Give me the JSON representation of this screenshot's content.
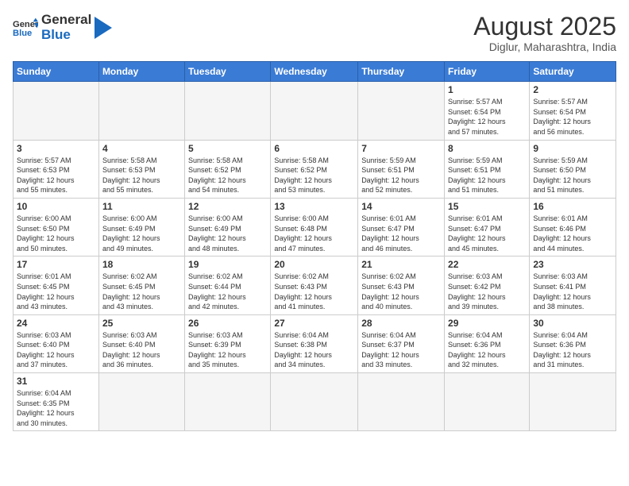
{
  "logo": {
    "text_general": "General",
    "text_blue": "Blue"
  },
  "header": {
    "month_title": "August 2025",
    "subtitle": "Diglur, Maharashtra, India"
  },
  "weekdays": [
    "Sunday",
    "Monday",
    "Tuesday",
    "Wednesday",
    "Thursday",
    "Friday",
    "Saturday"
  ],
  "weeks": [
    [
      {
        "day": "",
        "info": ""
      },
      {
        "day": "",
        "info": ""
      },
      {
        "day": "",
        "info": ""
      },
      {
        "day": "",
        "info": ""
      },
      {
        "day": "",
        "info": ""
      },
      {
        "day": "1",
        "info": "Sunrise: 5:57 AM\nSunset: 6:54 PM\nDaylight: 12 hours\nand 57 minutes."
      },
      {
        "day": "2",
        "info": "Sunrise: 5:57 AM\nSunset: 6:54 PM\nDaylight: 12 hours\nand 56 minutes."
      }
    ],
    [
      {
        "day": "3",
        "info": "Sunrise: 5:57 AM\nSunset: 6:53 PM\nDaylight: 12 hours\nand 55 minutes."
      },
      {
        "day": "4",
        "info": "Sunrise: 5:58 AM\nSunset: 6:53 PM\nDaylight: 12 hours\nand 55 minutes."
      },
      {
        "day": "5",
        "info": "Sunrise: 5:58 AM\nSunset: 6:52 PM\nDaylight: 12 hours\nand 54 minutes."
      },
      {
        "day": "6",
        "info": "Sunrise: 5:58 AM\nSunset: 6:52 PM\nDaylight: 12 hours\nand 53 minutes."
      },
      {
        "day": "7",
        "info": "Sunrise: 5:59 AM\nSunset: 6:51 PM\nDaylight: 12 hours\nand 52 minutes."
      },
      {
        "day": "8",
        "info": "Sunrise: 5:59 AM\nSunset: 6:51 PM\nDaylight: 12 hours\nand 51 minutes."
      },
      {
        "day": "9",
        "info": "Sunrise: 5:59 AM\nSunset: 6:50 PM\nDaylight: 12 hours\nand 51 minutes."
      }
    ],
    [
      {
        "day": "10",
        "info": "Sunrise: 6:00 AM\nSunset: 6:50 PM\nDaylight: 12 hours\nand 50 minutes."
      },
      {
        "day": "11",
        "info": "Sunrise: 6:00 AM\nSunset: 6:49 PM\nDaylight: 12 hours\nand 49 minutes."
      },
      {
        "day": "12",
        "info": "Sunrise: 6:00 AM\nSunset: 6:49 PM\nDaylight: 12 hours\nand 48 minutes."
      },
      {
        "day": "13",
        "info": "Sunrise: 6:00 AM\nSunset: 6:48 PM\nDaylight: 12 hours\nand 47 minutes."
      },
      {
        "day": "14",
        "info": "Sunrise: 6:01 AM\nSunset: 6:47 PM\nDaylight: 12 hours\nand 46 minutes."
      },
      {
        "day": "15",
        "info": "Sunrise: 6:01 AM\nSunset: 6:47 PM\nDaylight: 12 hours\nand 45 minutes."
      },
      {
        "day": "16",
        "info": "Sunrise: 6:01 AM\nSunset: 6:46 PM\nDaylight: 12 hours\nand 44 minutes."
      }
    ],
    [
      {
        "day": "17",
        "info": "Sunrise: 6:01 AM\nSunset: 6:45 PM\nDaylight: 12 hours\nand 43 minutes."
      },
      {
        "day": "18",
        "info": "Sunrise: 6:02 AM\nSunset: 6:45 PM\nDaylight: 12 hours\nand 43 minutes."
      },
      {
        "day": "19",
        "info": "Sunrise: 6:02 AM\nSunset: 6:44 PM\nDaylight: 12 hours\nand 42 minutes."
      },
      {
        "day": "20",
        "info": "Sunrise: 6:02 AM\nSunset: 6:43 PM\nDaylight: 12 hours\nand 41 minutes."
      },
      {
        "day": "21",
        "info": "Sunrise: 6:02 AM\nSunset: 6:43 PM\nDaylight: 12 hours\nand 40 minutes."
      },
      {
        "day": "22",
        "info": "Sunrise: 6:03 AM\nSunset: 6:42 PM\nDaylight: 12 hours\nand 39 minutes."
      },
      {
        "day": "23",
        "info": "Sunrise: 6:03 AM\nSunset: 6:41 PM\nDaylight: 12 hours\nand 38 minutes."
      }
    ],
    [
      {
        "day": "24",
        "info": "Sunrise: 6:03 AM\nSunset: 6:40 PM\nDaylight: 12 hours\nand 37 minutes."
      },
      {
        "day": "25",
        "info": "Sunrise: 6:03 AM\nSunset: 6:40 PM\nDaylight: 12 hours\nand 36 minutes."
      },
      {
        "day": "26",
        "info": "Sunrise: 6:03 AM\nSunset: 6:39 PM\nDaylight: 12 hours\nand 35 minutes."
      },
      {
        "day": "27",
        "info": "Sunrise: 6:04 AM\nSunset: 6:38 PM\nDaylight: 12 hours\nand 34 minutes."
      },
      {
        "day": "28",
        "info": "Sunrise: 6:04 AM\nSunset: 6:37 PM\nDaylight: 12 hours\nand 33 minutes."
      },
      {
        "day": "29",
        "info": "Sunrise: 6:04 AM\nSunset: 6:36 PM\nDaylight: 12 hours\nand 32 minutes."
      },
      {
        "day": "30",
        "info": "Sunrise: 6:04 AM\nSunset: 6:36 PM\nDaylight: 12 hours\nand 31 minutes."
      }
    ],
    [
      {
        "day": "31",
        "info": "Sunrise: 6:04 AM\nSunset: 6:35 PM\nDaylight: 12 hours\nand 30 minutes."
      },
      {
        "day": "",
        "info": ""
      },
      {
        "day": "",
        "info": ""
      },
      {
        "day": "",
        "info": ""
      },
      {
        "day": "",
        "info": ""
      },
      {
        "day": "",
        "info": ""
      },
      {
        "day": "",
        "info": ""
      }
    ]
  ]
}
